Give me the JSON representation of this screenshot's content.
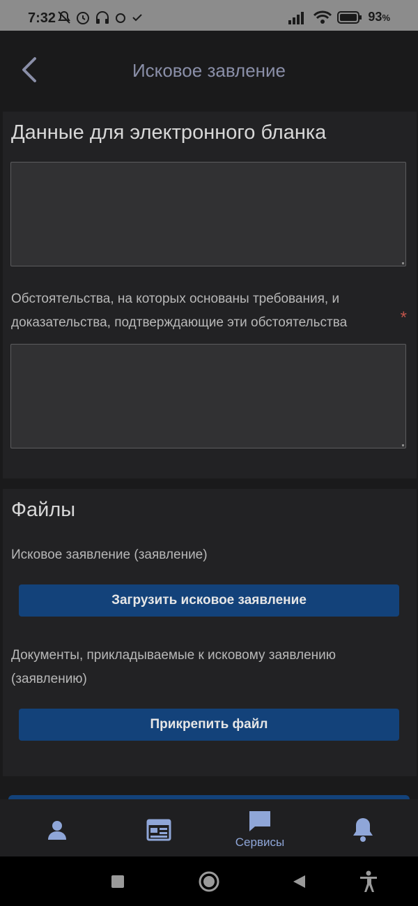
{
  "status_bar": {
    "time": "7:32",
    "battery_text": "93",
    "battery_unit": "%",
    "icons_left": [
      "muted-bell-icon",
      "alarm-icon",
      "headphones-icon",
      "alarm-small-icon",
      "check-icon"
    ],
    "icons_right": [
      "signal-icon",
      "wifi-icon",
      "battery-icon"
    ]
  },
  "header": {
    "title": "Исковое завление"
  },
  "form_section": {
    "title": "Данные для электронного бланка",
    "circumstances_label": "Обстоятельства, на которых основаны требования, и доказательства, подтверждающие эти обстоятельства",
    "required_mark": "*"
  },
  "files_section": {
    "title": "Файлы",
    "claim_label": "Исковое заявление (заявление)",
    "upload_claim_button": "Загрузить исковое заявление",
    "documents_label": "Документы, прикладываемые к исковому заявлению (заявлению)",
    "attach_file_button": "Прикрепить файл"
  },
  "bottom_nav": {
    "items": [
      {
        "icon": "profile-icon",
        "label": ""
      },
      {
        "icon": "news-icon",
        "label": ""
      },
      {
        "icon": "chat-icon",
        "label": "Сервисы"
      },
      {
        "icon": "bell-icon",
        "label": ""
      }
    ]
  },
  "colors": {
    "accent_blue": "#13427a",
    "nav_blue": "#8fa6d8",
    "required_red": "#c0544a"
  }
}
